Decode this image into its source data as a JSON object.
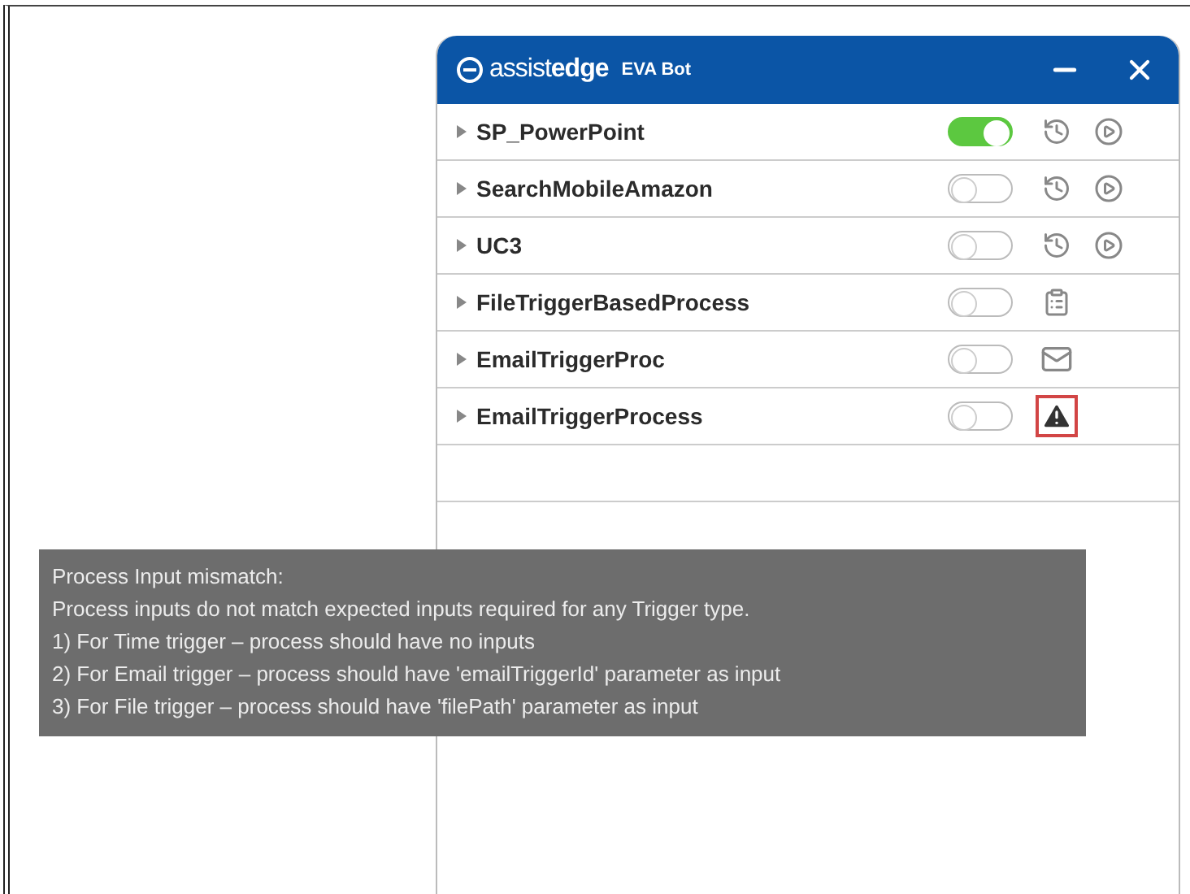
{
  "header": {
    "brand_light": "assist",
    "brand_bold": "edge",
    "title": "EVA Bot"
  },
  "processes": [
    {
      "name": "SP_PowerPoint",
      "on": true,
      "kind": "schedule"
    },
    {
      "name": "SearchMobileAmazon",
      "on": false,
      "kind": "schedule"
    },
    {
      "name": "UC3",
      "on": false,
      "kind": "schedule"
    },
    {
      "name": "FileTriggerBasedProcess",
      "on": false,
      "kind": "file"
    },
    {
      "name": "EmailTriggerProc",
      "on": false,
      "kind": "email"
    },
    {
      "name": "EmailTriggerProcess",
      "on": false,
      "kind": "warning"
    }
  ],
  "tooltip": {
    "lines": [
      "Process Input mismatch:",
      "Process inputs do not match expected inputs required for any Trigger type.",
      "1) For Time trigger – process should have no inputs",
      "2) For Email trigger – process should have 'emailTriggerId' parameter as input",
      "3) For File trigger – process should have 'filePath' parameter as input"
    ]
  }
}
